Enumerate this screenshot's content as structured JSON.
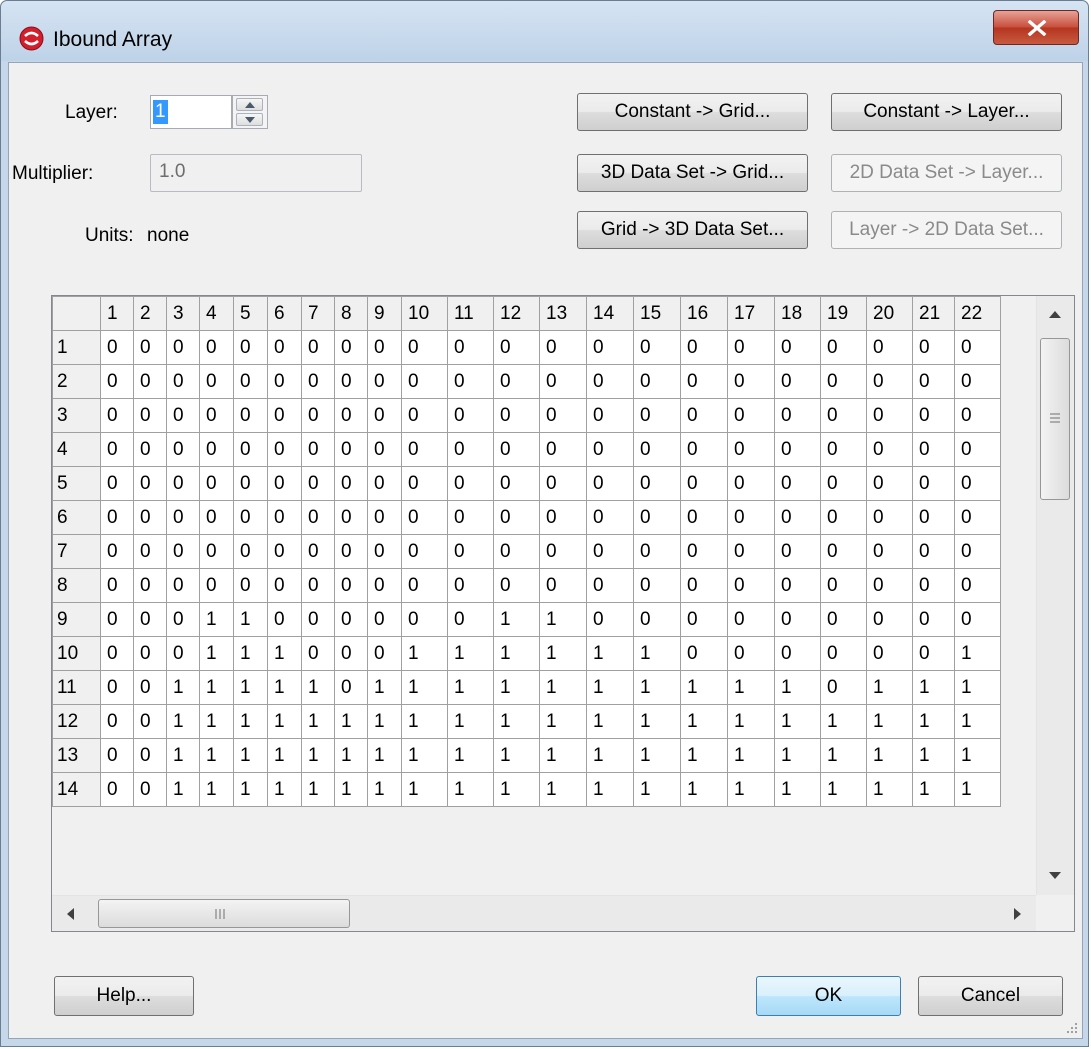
{
  "window": {
    "title": "Ibound Array",
    "accent": "#c8102e",
    "close_label": "X"
  },
  "form": {
    "layer_label": "Layer:",
    "layer_value": "1",
    "multiplier_label": "Multiplier:",
    "multiplier_value": "1.0",
    "units_label": "Units:",
    "units_value": "none"
  },
  "buttons": {
    "constant_grid": "Constant -> Grid...",
    "constant_layer": "Constant -> Layer...",
    "dataset3d_grid": "3D Data Set -> Grid...",
    "dataset2d_layer": "2D Data Set -> Layer...",
    "grid_dataset3d": "Grid -> 3D Data Set...",
    "layer_dataset2d": "Layer -> 2D Data Set...",
    "help": "Help...",
    "ok": "OK",
    "cancel": "Cancel"
  },
  "grid": {
    "columns": [
      "1",
      "2",
      "3",
      "4",
      "5",
      "6",
      "7",
      "8",
      "9",
      "10",
      "11",
      "12",
      "13",
      "14",
      "15",
      "16",
      "17",
      "18",
      "19",
      "20",
      "21",
      "22"
    ],
    "rows": [
      {
        "label": "1",
        "cells": [
          0,
          0,
          0,
          0,
          0,
          0,
          0,
          0,
          0,
          0,
          0,
          0,
          0,
          0,
          0,
          0,
          0,
          0,
          0,
          0,
          0,
          0
        ]
      },
      {
        "label": "2",
        "cells": [
          0,
          0,
          0,
          0,
          0,
          0,
          0,
          0,
          0,
          0,
          0,
          0,
          0,
          0,
          0,
          0,
          0,
          0,
          0,
          0,
          0,
          0
        ]
      },
      {
        "label": "3",
        "cells": [
          0,
          0,
          0,
          0,
          0,
          0,
          0,
          0,
          0,
          0,
          0,
          0,
          0,
          0,
          0,
          0,
          0,
          0,
          0,
          0,
          0,
          0
        ]
      },
      {
        "label": "4",
        "cells": [
          0,
          0,
          0,
          0,
          0,
          0,
          0,
          0,
          0,
          0,
          0,
          0,
          0,
          0,
          0,
          0,
          0,
          0,
          0,
          0,
          0,
          0
        ]
      },
      {
        "label": "5",
        "cells": [
          0,
          0,
          0,
          0,
          0,
          0,
          0,
          0,
          0,
          0,
          0,
          0,
          0,
          0,
          0,
          0,
          0,
          0,
          0,
          0,
          0,
          0
        ]
      },
      {
        "label": "6",
        "cells": [
          0,
          0,
          0,
          0,
          0,
          0,
          0,
          0,
          0,
          0,
          0,
          0,
          0,
          0,
          0,
          0,
          0,
          0,
          0,
          0,
          0,
          0
        ]
      },
      {
        "label": "7",
        "cells": [
          0,
          0,
          0,
          0,
          0,
          0,
          0,
          0,
          0,
          0,
          0,
          0,
          0,
          0,
          0,
          0,
          0,
          0,
          0,
          0,
          0,
          0
        ]
      },
      {
        "label": "8",
        "cells": [
          0,
          0,
          0,
          0,
          0,
          0,
          0,
          0,
          0,
          0,
          0,
          0,
          0,
          0,
          0,
          0,
          0,
          0,
          0,
          0,
          0,
          0
        ]
      },
      {
        "label": "9",
        "cells": [
          0,
          0,
          0,
          1,
          1,
          0,
          0,
          0,
          0,
          0,
          0,
          1,
          1,
          0,
          0,
          0,
          0,
          0,
          0,
          0,
          0,
          0
        ]
      },
      {
        "label": "10",
        "cells": [
          0,
          0,
          0,
          1,
          1,
          1,
          0,
          0,
          0,
          1,
          1,
          1,
          1,
          1,
          1,
          0,
          0,
          0,
          0,
          0,
          0,
          1
        ]
      },
      {
        "label": "11",
        "cells": [
          0,
          0,
          1,
          1,
          1,
          1,
          1,
          0,
          1,
          1,
          1,
          1,
          1,
          1,
          1,
          1,
          1,
          1,
          0,
          1,
          1,
          1
        ]
      },
      {
        "label": "12",
        "cells": [
          0,
          0,
          1,
          1,
          1,
          1,
          1,
          1,
          1,
          1,
          1,
          1,
          1,
          1,
          1,
          1,
          1,
          1,
          1,
          1,
          1,
          1
        ]
      },
      {
        "label": "13",
        "cells": [
          0,
          0,
          1,
          1,
          1,
          1,
          1,
          1,
          1,
          1,
          1,
          1,
          1,
          1,
          1,
          1,
          1,
          1,
          1,
          1,
          1,
          1
        ]
      },
      {
        "label": "14",
        "cells": [
          0,
          0,
          1,
          1,
          1,
          1,
          1,
          1,
          1,
          1,
          1,
          1,
          1,
          1,
          1,
          1,
          1,
          1,
          1,
          1,
          1,
          1
        ]
      }
    ]
  }
}
